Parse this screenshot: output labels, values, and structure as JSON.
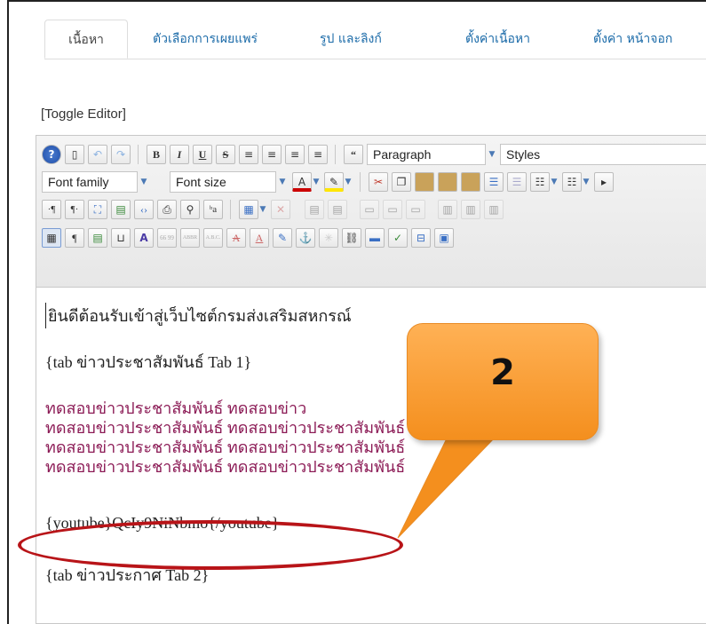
{
  "tabs": [
    "เนื้อหา",
    "ตัวเลือกการเผยแพร่",
    "รูป และลิงก์",
    "ตั้งค่าเนื้อหา",
    "ตั้งค่า หน้าจอก"
  ],
  "toggle_editor": "[Toggle Editor]",
  "toolbar": {
    "row1": {
      "bold": "B",
      "italic": "I",
      "underline": "U",
      "strike": "S",
      "blockquote_label": "“",
      "format_select": "Paragraph",
      "styles_select": "Styles"
    },
    "row2": {
      "font_family": "Font family",
      "font_size": "Font size",
      "text_color_label": "A"
    },
    "row3": {
      "ltr": "·¶",
      "rtl": "¶·",
      "sub": "ᵇa"
    },
    "row4": {
      "pilcrow": "¶",
      "font_a": "A",
      "abbr": "ABBR",
      "acronym": "A.B.C.",
      "strike_a": "A",
      "box_a": "A",
      "quote": "66 99"
    }
  },
  "content": {
    "welcome": "ยินดีต้อนรับเข้าสู่เว็บไซต์กรมส่งเสริมสหกรณ์",
    "tab1": "{tab ข่าวประชาสัมพันธ์ Tab 1}",
    "red_lines": [
      "ทดสอบข่าวประชาสัมพันธ์ ทดสอบข่าว",
      "ทดสอบข่าวประชาสัมพันธ์ ทดสอบข่าวประชาสัมพันธ์",
      "ทดสอบข่าวประชาสัมพันธ์ ทดสอบข่าวประชาสัมพันธ์",
      "ทดสอบข่าวประชาสัมพันธ์ ทดสอบข่าวประชาสัมพันธ์"
    ],
    "youtube": "{youtube}QcIy9NiNbmo{/youtube}",
    "tab2": "{tab ข่าวประกาศ Tab 2}"
  },
  "callout": {
    "number": "2",
    "fill": "#f7982a",
    "oval_color": "#b81418"
  }
}
